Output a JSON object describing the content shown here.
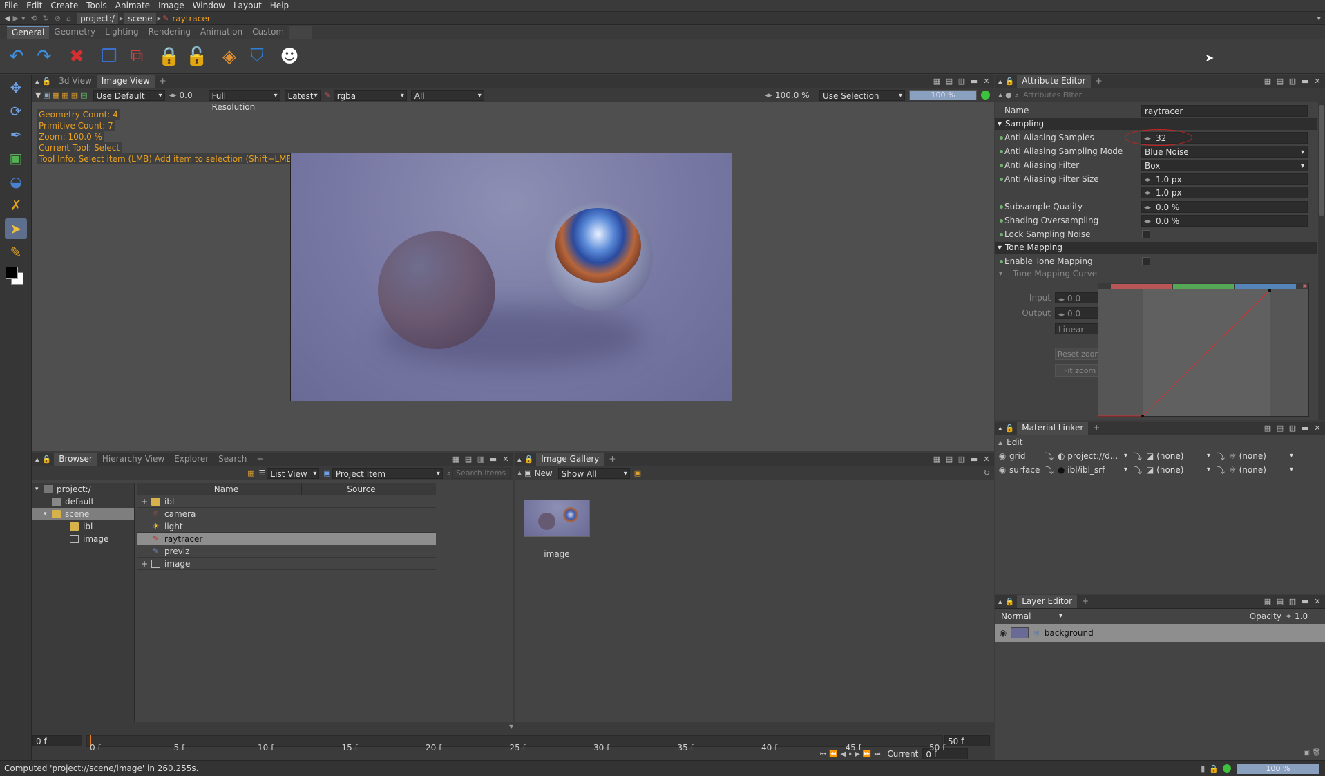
{
  "menubar": [
    "File",
    "Edit",
    "Create",
    "Tools",
    "Animate",
    "Image",
    "Window",
    "Layout",
    "Help"
  ],
  "path": {
    "root": "project:/",
    "scene": "scene",
    "current": "raytracer"
  },
  "top_tabs": [
    "General",
    "Geometry",
    "Lighting",
    "Rendering",
    "Animation",
    "Custom"
  ],
  "viewer": {
    "tabs": [
      "3d View",
      "Image View"
    ],
    "exposure_value": "0.0",
    "view_mode": "Use Default",
    "resolution": "Full Resolution",
    "version": "Latest",
    "channels": "rgba",
    "layers": "All",
    "zoom_value": "100.0 %",
    "selection_mode": "Use Selection",
    "progress_label": "100 %",
    "progress": 1.0,
    "info": {
      "geometry": "Geometry Count: 4",
      "primitive": "Primitive Count: 7",
      "zoom": "Zoom: 100.0 %",
      "tool": "Current Tool: Select",
      "tool_info": "Tool Info: Select item (LMB)  Add item to selection (Shift+LMB)  Toggle item selection (Ctrl+LMB)  Selection rect (LMB-Drag)"
    }
  },
  "browser": {
    "tabs": [
      "Browser",
      "Hierarchy View",
      "Explorer",
      "Search"
    ],
    "view_mode": "List View",
    "filter": "Project Item",
    "search_placeholder": "Search Items",
    "tree": [
      {
        "label": "project:/",
        "depth": 0
      },
      {
        "label": "default",
        "depth": 1
      },
      {
        "label": "scene",
        "depth": 1
      },
      {
        "label": "ibl",
        "depth": 2
      },
      {
        "label": "image",
        "depth": 2
      }
    ],
    "columns": [
      "Name",
      "Source"
    ],
    "rows": [
      {
        "name": "ibl",
        "expand": "+"
      },
      {
        "name": "camera",
        "expand": ""
      },
      {
        "name": "light",
        "expand": ""
      },
      {
        "name": "raytracer",
        "expand": ""
      },
      {
        "name": "previz",
        "expand": ""
      },
      {
        "name": "image",
        "expand": "+"
      }
    ]
  },
  "gallery": {
    "tab": "Image Gallery",
    "new_label": "New",
    "filter": "Show All",
    "thumb_label": "image"
  },
  "attribute_editor": {
    "tab": "Attribute Editor",
    "filter_placeholder": "Attributes Filter",
    "name_label": "Name",
    "name_value": "raytracer",
    "sampling_header": "Sampling",
    "aa_samples_label": "Anti Aliasing Samples",
    "aa_samples": "32",
    "aa_mode_label": "Anti Aliasing Sampling Mode",
    "aa_mode": "Blue Noise",
    "aa_filter_label": "Anti Aliasing Filter",
    "aa_filter": "Box",
    "aa_filter_size_label": "Anti Aliasing Filter Size",
    "aa_filter_size_x": "1.0 px",
    "aa_filter_size_y": "1.0 px",
    "subsample_label": "Subsample Quality",
    "subsample": "0.0 %",
    "shading_label": "Shading Oversampling",
    "shading": "0.0 %",
    "lock_noise_label": "Lock Sampling Noise",
    "tonemap_header": "Tone Mapping",
    "enable_tonemap_label": "Enable Tone Mapping",
    "curve_header": "Tone Mapping Curve",
    "input_label": "Input",
    "input_value": "0.0",
    "output_label": "Output",
    "output_value": "0.0",
    "interp": "Linear",
    "reset_zoom": "Reset zoom",
    "fit_zoom": "Fit zoom"
  },
  "material_linker": {
    "tab": "Material Linker",
    "edit_label": "Edit",
    "rows": [
      {
        "name": "grid",
        "material": "project://d...",
        "c2": "(none)",
        "c3": "(none)"
      },
      {
        "name": "surface",
        "material": "ibl/ibl_srf",
        "c2": "(none)",
        "c3": "(none)"
      }
    ]
  },
  "layer_editor": {
    "tab": "Layer Editor",
    "blend": "Normal",
    "opacity_label": "Opacity",
    "opacity": "1.0",
    "layer": "background"
  },
  "timeline": {
    "start": "0 f",
    "end": "50 f",
    "ticks": [
      "0 f",
      "5 f",
      "10 f",
      "15 f",
      "20 f",
      "25 f",
      "30 f",
      "35 f",
      "40 f",
      "45 f",
      "50 f"
    ],
    "current_label": "Current",
    "current": "0 f"
  },
  "status": {
    "message": "Computed 'project://scene/image' in 260.255s.",
    "zoom": "100 %"
  }
}
